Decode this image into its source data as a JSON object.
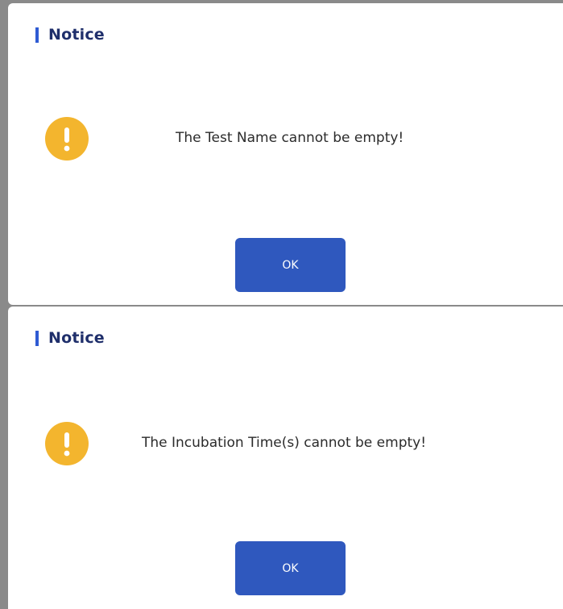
{
  "colors": {
    "accent": "#2f5bd3",
    "title": "#1f2f6b",
    "warning": "#f3b52e",
    "button": "#2f58be"
  },
  "dialogs": [
    {
      "title": "Notice",
      "icon": "warning-exclamation-icon",
      "message": "The Test Name cannot be empty!",
      "ok_label": "OK"
    },
    {
      "title": "Notice",
      "icon": "warning-exclamation-icon",
      "message": "The Incubation Time(s) cannot be empty!",
      "ok_label": "OK"
    }
  ]
}
